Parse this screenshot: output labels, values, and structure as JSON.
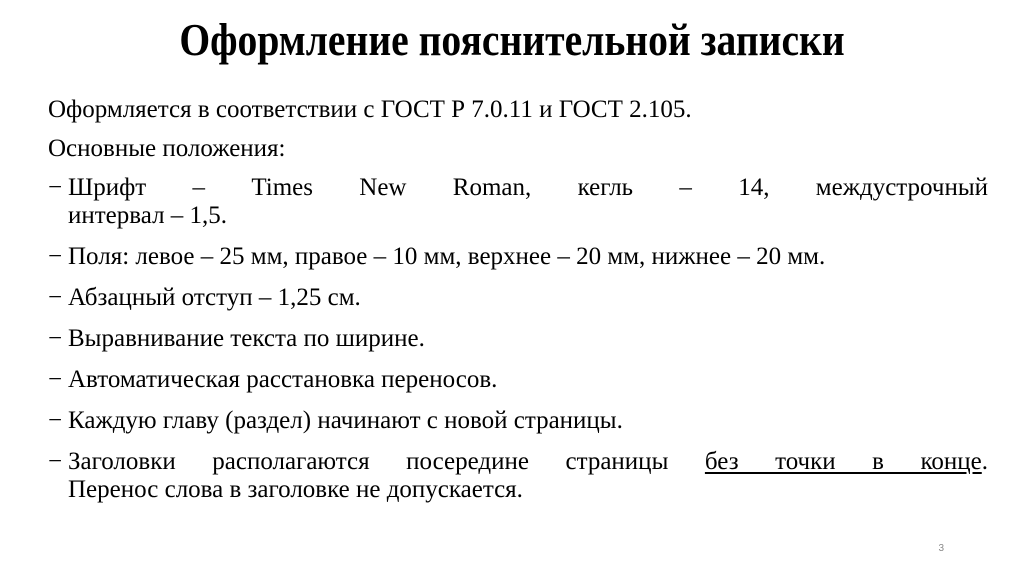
{
  "slide": {
    "title": "Оформление пояснительной записки",
    "intro": "Оформляется в соответствии с ГОСТ Р 7.0.11 и ГОСТ 2.105.",
    "subheading": "Основные положения:",
    "bullet_marker": "−",
    "bullets": [
      {
        "line1": "Шрифт – Times New Roman, кегль – 14, междустрочный",
        "line2": "интервал – 1,5."
      },
      {
        "text": "Поля: левое – 25 мм, правое – 10 мм, верхнее – 20 мм, нижнее – 20 мм."
      },
      {
        "text": "Абзацный отступ – 1,25 см."
      },
      {
        "text": "Выравнивание текста по ширине."
      },
      {
        "text": "Автоматическая расстановка переносов."
      },
      {
        "text": "Каждую главу (раздел) начинают с новой страницы."
      },
      {
        "line1_plain": "Заголовки располагаются посередине страницы ",
        "line1_underlined": "без точки в конце",
        "line1_end": ".",
        "line2": "Перенос слова в заголовке не допускается."
      }
    ],
    "page_number": "3"
  }
}
